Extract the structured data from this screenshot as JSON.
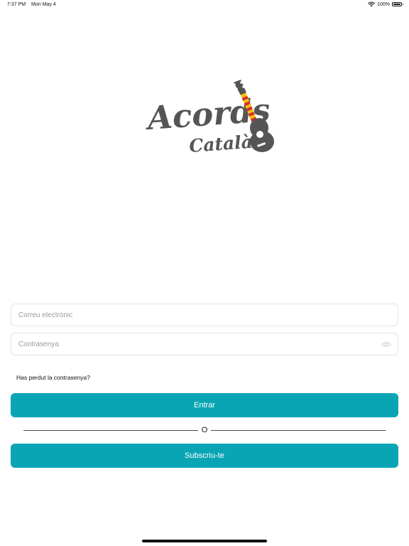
{
  "status_bar": {
    "time": "7:37 PM",
    "date": "Mon May 4",
    "battery": "100%",
    "battery_level": 1.0,
    "icons": [
      "wifi-icon",
      "battery-icon"
    ]
  },
  "logo": {
    "line1": "Acords",
    "line2": "Català",
    "text_color": "#555555",
    "guitar_color": "#555555",
    "flag_colors": [
      "#f4c20d",
      "#d32f2f"
    ],
    "icon": "guitar-icon"
  },
  "login": {
    "email_placeholder": "Correu electrònic",
    "email_value": "",
    "password_placeholder": "Contrasenya",
    "password_value": "",
    "password_toggle_icon": "eye-icon",
    "forgot_password": "Has perdut la contrasenya?",
    "login_button": "Entrar",
    "separator_text": "O",
    "signup_button": "Subscriu-te"
  },
  "colors": {
    "accent": "#0aa5b5",
    "background": "#ffffff",
    "field_border": "#e3e3e3",
    "placeholder": "#9a9a9a"
  }
}
